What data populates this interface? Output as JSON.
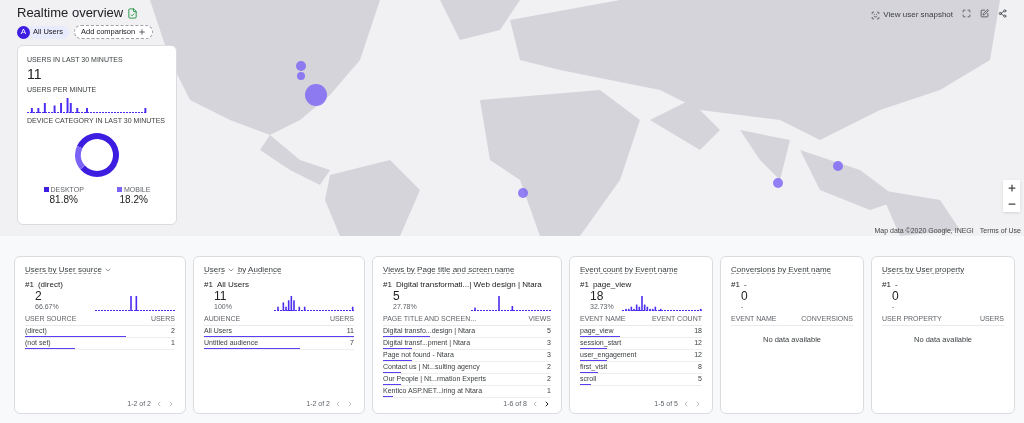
{
  "header": {
    "title": "Realtime overview",
    "chips": [
      {
        "kind": "segment",
        "avatar": "A",
        "label": "All Users"
      },
      {
        "kind": "add",
        "label": "Add comparison"
      }
    ]
  },
  "toolbar": {
    "snapshot_label": "View user snapshot"
  },
  "map": {
    "attribution": "Map data ©2020 Google, INEGI",
    "terms": "Terms of Use"
  },
  "summary": {
    "users_label": "USERS IN LAST 30 MINUTES",
    "users_value": "11",
    "per_minute_label": "USERS PER MINUTE",
    "device_label": "DEVICE CATEGORY IN LAST 30 MINUTES",
    "chart_data": {
      "type": "donut",
      "categories": [
        "DESKTOP",
        "MOBILE"
      ],
      "values": [
        81.8,
        18.2
      ]
    },
    "legend": [
      {
        "value": "81.8%",
        "color": "#3d1ee0"
      },
      {
        "value": "18.2%",
        "color": "#7b63f5"
      }
    ]
  },
  "cards": [
    {
      "title_parts": [
        {
          "text": "Users by User source",
          "dropdown": true
        }
      ],
      "rank": "#1",
      "top": "(direct)",
      "value": "2",
      "percent": "66.67%",
      "sparkline": true,
      "columns": [
        "USER SOURCE",
        "USERS"
      ],
      "rows": [
        {
          "name": "(direct)",
          "value": "2",
          "level": 0.67
        },
        {
          "name": "(not set)",
          "value": "1",
          "level": 0.33
        }
      ],
      "pager": "1-2 of 2",
      "next_enabled": false
    },
    {
      "title_parts": [
        {
          "text": "Users",
          "dropdown": true
        },
        {
          "text": "by Audience",
          "dropdown": false
        }
      ],
      "rank": "#1",
      "top": "All Users",
      "value": "11",
      "percent": "100%",
      "sparkline": true,
      "columns": [
        "AUDIENCE",
        "USERS"
      ],
      "rows": [
        {
          "name": "All Users",
          "value": "11",
          "level": 1
        },
        {
          "name": "Untitled audience",
          "value": "7",
          "level": 0.64
        }
      ],
      "pager": "1-2 of 2",
      "next_enabled": false
    },
    {
      "title_parts": [
        {
          "text": "Views by Page title and screen name",
          "dropdown": false
        }
      ],
      "rank": "#1",
      "top": "Digital transformati...| Web design | Ntara",
      "value": "5",
      "percent": "27.78%",
      "sparkline": true,
      "columns": [
        "PAGE TITLE AND SCREEN...",
        "VIEWS"
      ],
      "rows": [
        {
          "name": "Digital transfo...design | Ntara",
          "value": "5",
          "level": 0.28
        },
        {
          "name": "Digital transf...pment | Ntara",
          "value": "3",
          "level": 0.17
        },
        {
          "name": "Page not found - Ntara",
          "value": "3",
          "level": 0.17
        },
        {
          "name": "Contact us | Nt...sulting agency",
          "value": "2",
          "level": 0.11
        },
        {
          "name": "Our People | Nt...rmation Experts",
          "value": "2",
          "level": 0.11
        },
        {
          "name": "Kentico ASP.NET...iring at Ntara",
          "value": "1",
          "level": 0.06
        }
      ],
      "pager": "1-6 of 8",
      "next_enabled": true
    },
    {
      "title_parts": [
        {
          "text": "Event count by Event name",
          "dropdown": false
        }
      ],
      "rank": "#1",
      "top": "page_view",
      "value": "18",
      "percent": "32.73%",
      "sparkline": true,
      "columns": [
        "EVENT NAME",
        "EVENT COUNT"
      ],
      "rows": [
        {
          "name": "page_view",
          "value": "18",
          "level": 0.33
        },
        {
          "name": "session_start",
          "value": "12",
          "level": 0.22
        },
        {
          "name": "user_engagement",
          "value": "12",
          "level": 0.22
        },
        {
          "name": "first_visit",
          "value": "8",
          "level": 0.15
        },
        {
          "name": "scroll",
          "value": "5",
          "level": 0.09
        }
      ],
      "pager": "1-5 of 5",
      "next_enabled": false
    },
    {
      "title_parts": [
        {
          "text": "Conversions by Event name",
          "dropdown": false
        }
      ],
      "rank": "#1",
      "top": "-",
      "value": "0",
      "percent": "-",
      "sparkline": false,
      "columns": [
        "EVENT NAME",
        "CONVERSIONS"
      ],
      "empty_text": "No data available"
    },
    {
      "title_parts": [
        {
          "text": "Users by User property",
          "dropdown": false
        }
      ],
      "rank": "#1",
      "top": "-",
      "value": "0",
      "percent": "-",
      "sparkline": false,
      "columns": [
        "USER PROPERTY",
        "USERS"
      ],
      "empty_text": "No data available"
    }
  ]
}
